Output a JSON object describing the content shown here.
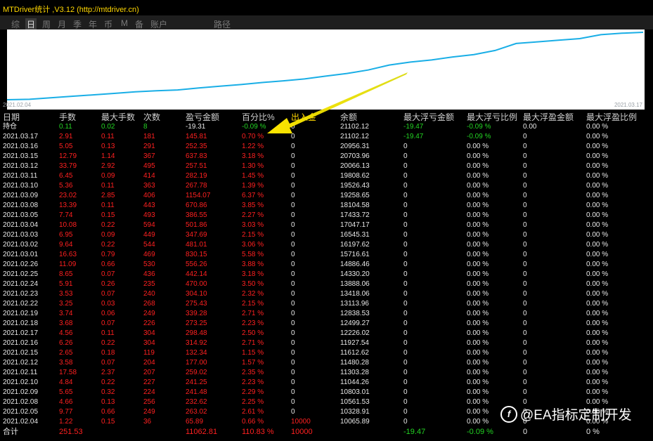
{
  "window": {
    "title": "MTDriver统计 ,V3.12 (http://mtdriver.cn)"
  },
  "tabs": [
    "综",
    "日",
    "周",
    "月",
    "季",
    "年",
    "币",
    "M",
    "备",
    "账户",
    "路径"
  ],
  "active_tab": "日",
  "chart": {
    "start_date": "2021.02.04",
    "end_date": "2021.03.17",
    "line_color": "#19aee6"
  },
  "columns": [
    "日期",
    "手数",
    "最大手数",
    "次数",
    "盈亏金额",
    "百分比%",
    "出入金",
    "余额",
    "最大浮亏金额",
    "最大浮亏比例",
    "最大浮盈金额",
    "最大浮盈比例"
  ],
  "position_row": {
    "date": "持仓",
    "lots": "0.11",
    "max_lots": "0.02",
    "trades": "8",
    "pnl": "-19.31",
    "pct": "-0.09 %",
    "io": "0",
    "balance": "21102.12",
    "max_dd": "-19.47",
    "max_dd_pct": "-0.09 %",
    "max_fp": "0.00",
    "max_fp_pct": "0.00 %"
  },
  "rows": [
    {
      "date": "2021.03.17",
      "lots": "2.91",
      "max_lots": "0.11",
      "trades": "181",
      "pnl": "145.81",
      "pct": "0.70 %",
      "io": "0",
      "balance": "21102.12",
      "max_dd": "-19.47",
      "max_dd_pct": "-0.09 %",
      "max_fp": "0",
      "max_fp_pct": "0.00 %"
    },
    {
      "date": "2021.03.16",
      "lots": "5.05",
      "max_lots": "0.13",
      "trades": "291",
      "pnl": "252.35",
      "pct": "1.22 %",
      "io": "0",
      "balance": "20956.31",
      "max_dd": "0",
      "max_dd_pct": "0.00 %",
      "max_fp": "0",
      "max_fp_pct": "0.00 %"
    },
    {
      "date": "2021.03.15",
      "lots": "12.79",
      "max_lots": "1.14",
      "trades": "367",
      "pnl": "637.83",
      "pct": "3.18 %",
      "io": "0",
      "balance": "20703.96",
      "max_dd": "0",
      "max_dd_pct": "0.00 %",
      "max_fp": "0",
      "max_fp_pct": "0.00 %"
    },
    {
      "date": "2021.03.12",
      "lots": "33.79",
      "max_lots": "2.92",
      "trades": "495",
      "pnl": "257.51",
      "pct": "1.30 %",
      "io": "0",
      "balance": "20066.13",
      "max_dd": "0",
      "max_dd_pct": "0.00 %",
      "max_fp": "0",
      "max_fp_pct": "0.00 %"
    },
    {
      "date": "2021.03.11",
      "lots": "6.45",
      "max_lots": "0.09",
      "trades": "414",
      "pnl": "282.19",
      "pct": "1.45 %",
      "io": "0",
      "balance": "19808.62",
      "max_dd": "0",
      "max_dd_pct": "0.00 %",
      "max_fp": "0",
      "max_fp_pct": "0.00 %"
    },
    {
      "date": "2021.03.10",
      "lots": "5.36",
      "max_lots": "0.11",
      "trades": "363",
      "pnl": "267.78",
      "pct": "1.39 %",
      "io": "0",
      "balance": "19526.43",
      "max_dd": "0",
      "max_dd_pct": "0.00 %",
      "max_fp": "0",
      "max_fp_pct": "0.00 %"
    },
    {
      "date": "2021.03.09",
      "lots": "23.02",
      "max_lots": "2.85",
      "trades": "406",
      "pnl": "1154.07",
      "pct": "6.37 %",
      "io": "0",
      "balance": "19258.65",
      "max_dd": "0",
      "max_dd_pct": "0.00 %",
      "max_fp": "0",
      "max_fp_pct": "0.00 %"
    },
    {
      "date": "2021.03.08",
      "lots": "13.39",
      "max_lots": "0.11",
      "trades": "443",
      "pnl": "670.86",
      "pct": "3.85 %",
      "io": "0",
      "balance": "18104.58",
      "max_dd": "0",
      "max_dd_pct": "0.00 %",
      "max_fp": "0",
      "max_fp_pct": "0.00 %"
    },
    {
      "date": "2021.03.05",
      "lots": "7.74",
      "max_lots": "0.15",
      "trades": "493",
      "pnl": "386.55",
      "pct": "2.27 %",
      "io": "0",
      "balance": "17433.72",
      "max_dd": "0",
      "max_dd_pct": "0.00 %",
      "max_fp": "0",
      "max_fp_pct": "0.00 %"
    },
    {
      "date": "2021.03.04",
      "lots": "10.08",
      "max_lots": "0.22",
      "trades": "594",
      "pnl": "501.86",
      "pct": "3.03 %",
      "io": "0",
      "balance": "17047.17",
      "max_dd": "0",
      "max_dd_pct": "0.00 %",
      "max_fp": "0",
      "max_fp_pct": "0.00 %"
    },
    {
      "date": "2021.03.03",
      "lots": "6.95",
      "max_lots": "0.09",
      "trades": "449",
      "pnl": "347.69",
      "pct": "2.15 %",
      "io": "0",
      "balance": "16545.31",
      "max_dd": "0",
      "max_dd_pct": "0.00 %",
      "max_fp": "0",
      "max_fp_pct": "0.00 %"
    },
    {
      "date": "2021.03.02",
      "lots": "9.64",
      "max_lots": "0.22",
      "trades": "544",
      "pnl": "481.01",
      "pct": "3.06 %",
      "io": "0",
      "balance": "16197.62",
      "max_dd": "0",
      "max_dd_pct": "0.00 %",
      "max_fp": "0",
      "max_fp_pct": "0.00 %"
    },
    {
      "date": "2021.03.01",
      "lots": "16.63",
      "max_lots": "0.79",
      "trades": "469",
      "pnl": "830.15",
      "pct": "5.58 %",
      "io": "0",
      "balance": "15716.61",
      "max_dd": "0",
      "max_dd_pct": "0.00 %",
      "max_fp": "0",
      "max_fp_pct": "0.00 %"
    },
    {
      "date": "2021.02.26",
      "lots": "11.09",
      "max_lots": "0.66",
      "trades": "530",
      "pnl": "556.26",
      "pct": "3.88 %",
      "io": "0",
      "balance": "14886.46",
      "max_dd": "0",
      "max_dd_pct": "0.00 %",
      "max_fp": "0",
      "max_fp_pct": "0.00 %"
    },
    {
      "date": "2021.02.25",
      "lots": "8.65",
      "max_lots": "0.07",
      "trades": "436",
      "pnl": "442.14",
      "pct": "3.18 %",
      "io": "0",
      "balance": "14330.20",
      "max_dd": "0",
      "max_dd_pct": "0.00 %",
      "max_fp": "0",
      "max_fp_pct": "0.00 %"
    },
    {
      "date": "2021.02.24",
      "lots": "5.91",
      "max_lots": "0.26",
      "trades": "235",
      "pnl": "470.00",
      "pct": "3.50 %",
      "io": "0",
      "balance": "13888.06",
      "max_dd": "0",
      "max_dd_pct": "0.00 %",
      "max_fp": "0",
      "max_fp_pct": "0.00 %"
    },
    {
      "date": "2021.02.23",
      "lots": "3.53",
      "max_lots": "0.07",
      "trades": "240",
      "pnl": "304.10",
      "pct": "2.32 %",
      "io": "0",
      "balance": "13418.06",
      "max_dd": "0",
      "max_dd_pct": "0.00 %",
      "max_fp": "0",
      "max_fp_pct": "0.00 %"
    },
    {
      "date": "2021.02.22",
      "lots": "3.25",
      "max_lots": "0.03",
      "trades": "268",
      "pnl": "275.43",
      "pct": "2.15 %",
      "io": "0",
      "balance": "13113.96",
      "max_dd": "0",
      "max_dd_pct": "0.00 %",
      "max_fp": "0",
      "max_fp_pct": "0.00 %"
    },
    {
      "date": "2021.02.19",
      "lots": "3.74",
      "max_lots": "0.06",
      "trades": "249",
      "pnl": "339.28",
      "pct": "2.71 %",
      "io": "0",
      "balance": "12838.53",
      "max_dd": "0",
      "max_dd_pct": "0.00 %",
      "max_fp": "0",
      "max_fp_pct": "0.00 %"
    },
    {
      "date": "2021.02.18",
      "lots": "3.68",
      "max_lots": "0.07",
      "trades": "226",
      "pnl": "273.25",
      "pct": "2.23 %",
      "io": "0",
      "balance": "12499.27",
      "max_dd": "0",
      "max_dd_pct": "0.00 %",
      "max_fp": "0",
      "max_fp_pct": "0.00 %"
    },
    {
      "date": "2021.02.17",
      "lots": "4.56",
      "max_lots": "0.11",
      "trades": "304",
      "pnl": "298.48",
      "pct": "2.50 %",
      "io": "0",
      "balance": "12226.02",
      "max_dd": "0",
      "max_dd_pct": "0.00 %",
      "max_fp": "0",
      "max_fp_pct": "0.00 %"
    },
    {
      "date": "2021.02.16",
      "lots": "6.26",
      "max_lots": "0.22",
      "trades": "304",
      "pnl": "314.92",
      "pct": "2.71 %",
      "io": "0",
      "balance": "11927.54",
      "max_dd": "0",
      "max_dd_pct": "0.00 %",
      "max_fp": "0",
      "max_fp_pct": "0.00 %"
    },
    {
      "date": "2021.02.15",
      "lots": "2.65",
      "max_lots": "0.18",
      "trades": "119",
      "pnl": "132.34",
      "pct": "1.15 %",
      "io": "0",
      "balance": "11612.62",
      "max_dd": "0",
      "max_dd_pct": "0.00 %",
      "max_fp": "0",
      "max_fp_pct": "0.00 %"
    },
    {
      "date": "2021.02.12",
      "lots": "3.58",
      "max_lots": "0.07",
      "trades": "204",
      "pnl": "177.00",
      "pct": "1.57 %",
      "io": "0",
      "balance": "11480.28",
      "max_dd": "0",
      "max_dd_pct": "0.00 %",
      "max_fp": "0",
      "max_fp_pct": "0.00 %"
    },
    {
      "date": "2021.02.11",
      "lots": "17.58",
      "max_lots": "2.37",
      "trades": "207",
      "pnl": "259.02",
      "pct": "2.35 %",
      "io": "0",
      "balance": "11303.28",
      "max_dd": "0",
      "max_dd_pct": "0.00 %",
      "max_fp": "0",
      "max_fp_pct": "0.00 %"
    },
    {
      "date": "2021.02.10",
      "lots": "4.84",
      "max_lots": "0.22",
      "trades": "227",
      "pnl": "241.25",
      "pct": "2.23 %",
      "io": "0",
      "balance": "11044.26",
      "max_dd": "0",
      "max_dd_pct": "0.00 %",
      "max_fp": "0",
      "max_fp_pct": "0.00 %"
    },
    {
      "date": "2021.02.09",
      "lots": "5.65",
      "max_lots": "0.32",
      "trades": "224",
      "pnl": "241.48",
      "pct": "2.29 %",
      "io": "0",
      "balance": "10803.01",
      "max_dd": "0",
      "max_dd_pct": "0.00 %",
      "max_fp": "0",
      "max_fp_pct": "0.00 %"
    },
    {
      "date": "2021.02.08",
      "lots": "4.66",
      "max_lots": "0.13",
      "trades": "256",
      "pnl": "232.62",
      "pct": "2.25 %",
      "io": "0",
      "balance": "10561.53",
      "max_dd": "0",
      "max_dd_pct": "0.00 %",
      "max_fp": "0",
      "max_fp_pct": "0.00 %"
    },
    {
      "date": "2021.02.05",
      "lots": "9.77",
      "max_lots": "0.66",
      "trades": "249",
      "pnl": "263.02",
      "pct": "2.61 %",
      "io": "0",
      "balance": "10328.91",
      "max_dd": "0",
      "max_dd_pct": "0.00 %",
      "max_fp": "0",
      "max_fp_pct": "0.00 %"
    },
    {
      "date": "2021.02.04",
      "lots": "1.22",
      "max_lots": "0.15",
      "trades": "36",
      "pnl": "65.89",
      "pct": "0.66 %",
      "io": "10000",
      "balance": "10065.89",
      "max_dd": "0",
      "max_dd_pct": "0.00 %",
      "max_fp": "0",
      "max_fp_pct": "0.00 %"
    }
  ],
  "total_row": {
    "label": "合计",
    "lots": "251.53",
    "pnl": "11062.81",
    "pct": "110.83 %",
    "io": "10000",
    "max_dd": "-19.47",
    "max_dd_pct": "-0.09 %",
    "max_fp": "0",
    "max_fp_pct": "0 %"
  },
  "watermark": "@EA指标定制开发"
}
